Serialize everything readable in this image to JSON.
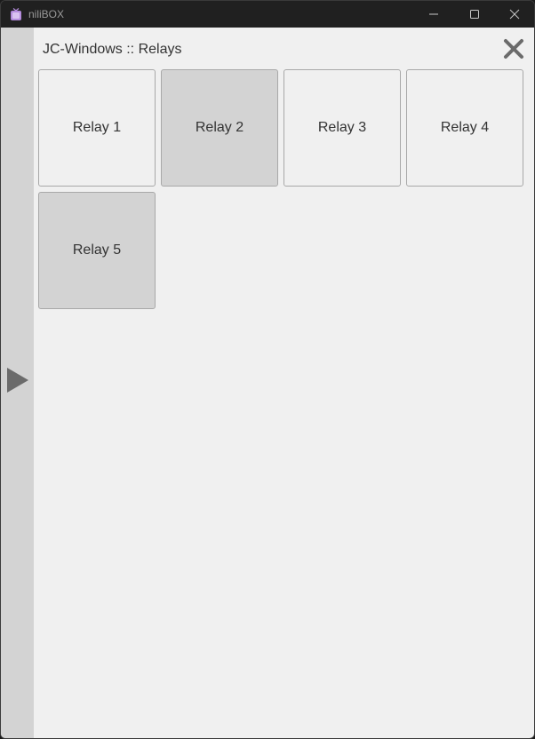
{
  "window": {
    "title": "niliBOX",
    "controls": [
      "minimize-icon",
      "maximize-icon",
      "close-icon"
    ]
  },
  "header": {
    "title": "JC-Windows :: Relays",
    "close_icon": "close-x-icon"
  },
  "sidebar": {
    "toggle_icon": "play-arrow-icon"
  },
  "relays": [
    {
      "label": "Relay 1",
      "active": false
    },
    {
      "label": "Relay 2",
      "active": true
    },
    {
      "label": "Relay 3",
      "active": false
    },
    {
      "label": "Relay 4",
      "active": false
    },
    {
      "label": "Relay 5",
      "active": true
    }
  ],
  "colors": {
    "titlebar": "#202020",
    "background": "#f0f0f0",
    "active_relay": "#d3d3d3",
    "border": "#a8a8a8",
    "text": "#333333",
    "app_icon": "#b48cdc"
  }
}
